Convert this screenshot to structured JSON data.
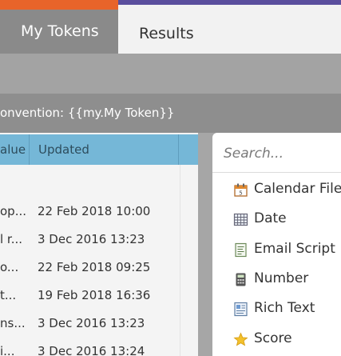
{
  "tabs": {
    "active_label": "My Tokens",
    "results_label": "Results"
  },
  "convention": {
    "text": "onvention: {{my.My Token}}"
  },
  "table": {
    "headers": {
      "value": "alue",
      "updated": "Updated"
    },
    "rows": [
      {
        "value": "op...",
        "updated": "22 Feb 2018 10:00"
      },
      {
        "value": "l r...",
        "updated": "3 Dec 2016 13:23"
      },
      {
        "value": "o...",
        "updated": "22 Feb 2018 09:25"
      },
      {
        "value": "t...",
        "updated": "19 Feb 2018 16:36"
      },
      {
        "value": "ns...",
        "updated": "3 Dec 2016 13:23"
      },
      {
        "value": "i...",
        "updated": "3 Dec 2016 13:24"
      }
    ]
  },
  "panel": {
    "search_placeholder": "Search...",
    "items": [
      {
        "label": "Calendar File",
        "icon": "calendar-icon"
      },
      {
        "label": "Date",
        "icon": "date-grid-icon"
      },
      {
        "label": "Email Script",
        "icon": "script-icon"
      },
      {
        "label": "Number",
        "icon": "calculator-icon"
      },
      {
        "label": "Rich Text",
        "icon": "rich-text-icon"
      },
      {
        "label": "Score",
        "icon": "star-icon"
      }
    ]
  },
  "colors": {
    "accent_orange": "#e8642a",
    "accent_purple": "#5a4e9d",
    "header_blue": "#75b7d7",
    "star": "#f3c12c"
  }
}
